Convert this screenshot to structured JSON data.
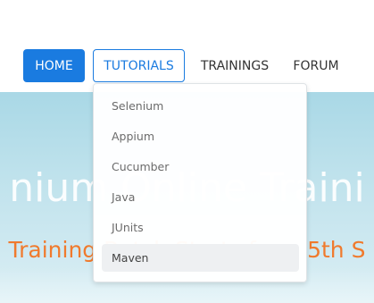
{
  "nav": {
    "items": [
      {
        "label": "HOME"
      },
      {
        "label": "TUTORIALS"
      },
      {
        "label": "TRAININGS"
      },
      {
        "label": "FORUM"
      }
    ]
  },
  "dropdown": {
    "items": [
      {
        "label": "Selenium"
      },
      {
        "label": "Appium"
      },
      {
        "label": "Cucumber"
      },
      {
        "label": "Java"
      },
      {
        "label": "JUnits"
      },
      {
        "label": "Maven"
      }
    ],
    "highlighted": "Maven"
  },
  "hero": {
    "title": "nium Online Traini",
    "subtitle": "Training Batch Starts from 5th S"
  },
  "colors": {
    "accent": "#1a7be0",
    "subtitle": "#f07a2d"
  }
}
